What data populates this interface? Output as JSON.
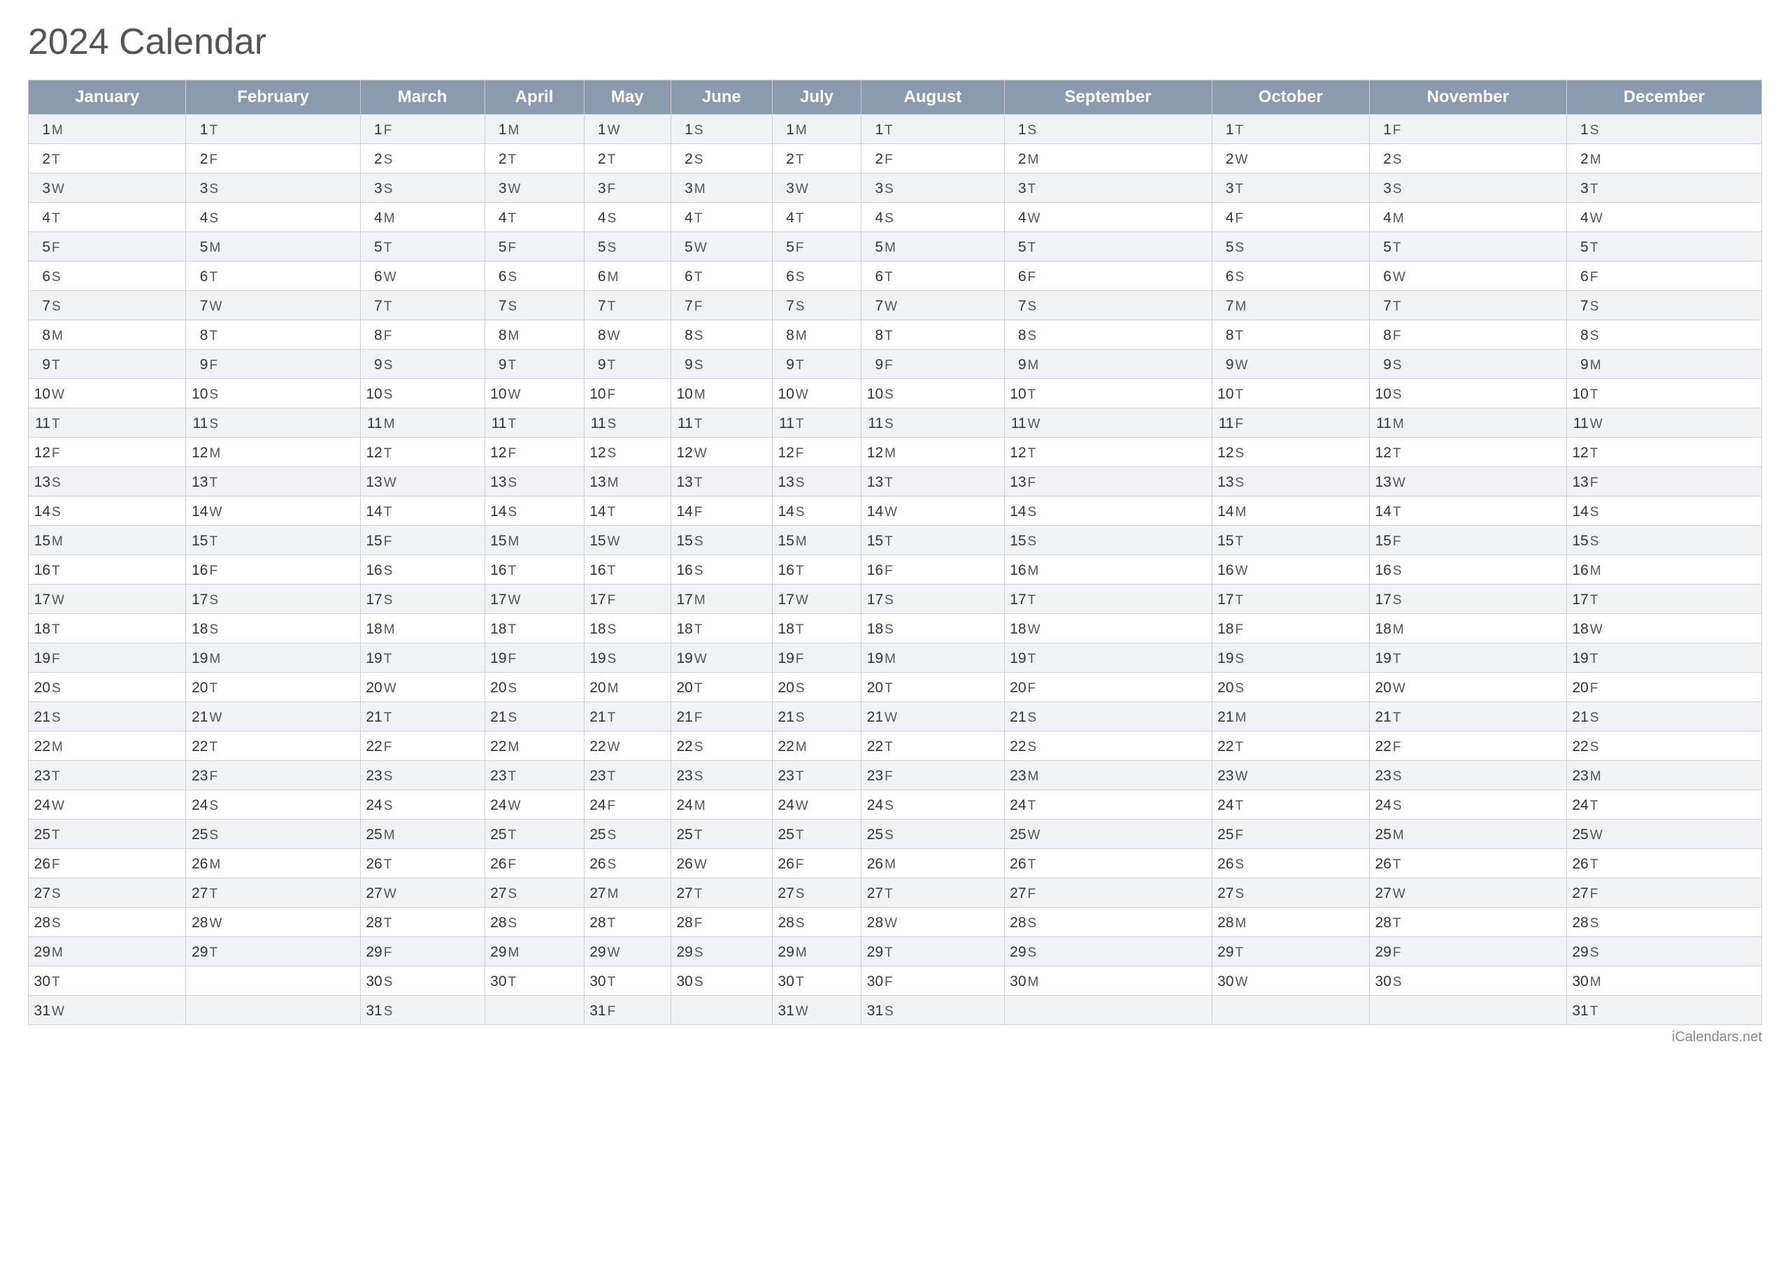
{
  "title": "2024 Calendar",
  "months": [
    "January",
    "February",
    "March",
    "April",
    "May",
    "June",
    "July",
    "August",
    "September",
    "October",
    "November",
    "December"
  ],
  "footer": "iCalendars.net",
  "rows": [
    {
      "day": 1,
      "days": [
        "M",
        "T",
        "F",
        "M",
        "W",
        "S",
        "M",
        "T",
        "S",
        "T",
        "F",
        "S"
      ]
    },
    {
      "day": 2,
      "days": [
        "T",
        "F",
        "S",
        "T",
        "T",
        "S",
        "T",
        "F",
        "M",
        "W",
        "S",
        "M"
      ]
    },
    {
      "day": 3,
      "days": [
        "W",
        "S",
        "S",
        "W",
        "F",
        "M",
        "W",
        "S",
        "T",
        "T",
        "S",
        "T"
      ]
    },
    {
      "day": 4,
      "days": [
        "T",
        "S",
        "M",
        "T",
        "S",
        "T",
        "T",
        "S",
        "W",
        "F",
        "M",
        "W"
      ]
    },
    {
      "day": 5,
      "days": [
        "F",
        "M",
        "T",
        "F",
        "S",
        "W",
        "F",
        "M",
        "T",
        "S",
        "T",
        "T"
      ]
    },
    {
      "day": 6,
      "days": [
        "S",
        "T",
        "W",
        "S",
        "M",
        "T",
        "S",
        "T",
        "F",
        "S",
        "W",
        "F"
      ]
    },
    {
      "day": 7,
      "days": [
        "S",
        "W",
        "T",
        "S",
        "T",
        "F",
        "S",
        "W",
        "S",
        "M",
        "T",
        "S"
      ]
    },
    {
      "day": 8,
      "days": [
        "M",
        "T",
        "F",
        "M",
        "W",
        "S",
        "M",
        "T",
        "S",
        "T",
        "F",
        "S"
      ]
    },
    {
      "day": 9,
      "days": [
        "T",
        "F",
        "S",
        "T",
        "T",
        "S",
        "T",
        "F",
        "M",
        "W",
        "S",
        "M"
      ]
    },
    {
      "day": 10,
      "days": [
        "W",
        "S",
        "S",
        "W",
        "F",
        "M",
        "W",
        "S",
        "T",
        "T",
        "S",
        "T"
      ]
    },
    {
      "day": 11,
      "days": [
        "T",
        "S",
        "M",
        "T",
        "S",
        "T",
        "T",
        "S",
        "W",
        "F",
        "M",
        "W"
      ]
    },
    {
      "day": 12,
      "days": [
        "F",
        "M",
        "T",
        "F",
        "S",
        "W",
        "F",
        "M",
        "T",
        "S",
        "T",
        "T"
      ]
    },
    {
      "day": 13,
      "days": [
        "S",
        "T",
        "W",
        "S",
        "M",
        "T",
        "S",
        "T",
        "F",
        "S",
        "W",
        "F"
      ]
    },
    {
      "day": 14,
      "days": [
        "S",
        "W",
        "T",
        "S",
        "T",
        "F",
        "S",
        "W",
        "S",
        "M",
        "T",
        "S"
      ]
    },
    {
      "day": 15,
      "days": [
        "M",
        "T",
        "F",
        "M",
        "W",
        "S",
        "M",
        "T",
        "S",
        "T",
        "F",
        "S"
      ]
    },
    {
      "day": 16,
      "days": [
        "T",
        "F",
        "S",
        "T",
        "T",
        "S",
        "T",
        "F",
        "M",
        "W",
        "S",
        "M"
      ]
    },
    {
      "day": 17,
      "days": [
        "W",
        "S",
        "S",
        "W",
        "F",
        "M",
        "W",
        "S",
        "T",
        "T",
        "S",
        "T"
      ]
    },
    {
      "day": 18,
      "days": [
        "T",
        "S",
        "M",
        "T",
        "S",
        "T",
        "T",
        "S",
        "W",
        "F",
        "M",
        "W"
      ]
    },
    {
      "day": 19,
      "days": [
        "F",
        "M",
        "T",
        "F",
        "S",
        "W",
        "F",
        "M",
        "T",
        "S",
        "T",
        "T"
      ]
    },
    {
      "day": 20,
      "days": [
        "S",
        "T",
        "W",
        "S",
        "M",
        "T",
        "S",
        "T",
        "F",
        "S",
        "W",
        "F"
      ]
    },
    {
      "day": 21,
      "days": [
        "S",
        "W",
        "T",
        "S",
        "T",
        "F",
        "S",
        "W",
        "S",
        "M",
        "T",
        "S"
      ]
    },
    {
      "day": 22,
      "days": [
        "M",
        "T",
        "F",
        "M",
        "W",
        "S",
        "M",
        "T",
        "S",
        "T",
        "F",
        "S"
      ]
    },
    {
      "day": 23,
      "days": [
        "T",
        "F",
        "S",
        "T",
        "T",
        "S",
        "T",
        "F",
        "M",
        "W",
        "S",
        "M"
      ]
    },
    {
      "day": 24,
      "days": [
        "W",
        "S",
        "S",
        "W",
        "F",
        "M",
        "W",
        "S",
        "T",
        "T",
        "S",
        "T"
      ]
    },
    {
      "day": 25,
      "days": [
        "T",
        "S",
        "M",
        "T",
        "S",
        "T",
        "T",
        "S",
        "W",
        "F",
        "M",
        "W"
      ]
    },
    {
      "day": 26,
      "days": [
        "F",
        "M",
        "T",
        "F",
        "S",
        "W",
        "F",
        "M",
        "T",
        "S",
        "T",
        "T"
      ]
    },
    {
      "day": 27,
      "days": [
        "S",
        "T",
        "W",
        "S",
        "M",
        "T",
        "S",
        "T",
        "F",
        "S",
        "W",
        "F"
      ]
    },
    {
      "day": 28,
      "days": [
        "S",
        "W",
        "T",
        "S",
        "T",
        "F",
        "S",
        "W",
        "S",
        "M",
        "T",
        "S"
      ]
    },
    {
      "day": 29,
      "days": [
        "M",
        "T",
        "F",
        "M",
        "W",
        "S",
        "M",
        "T",
        "S",
        "T",
        "F",
        "S"
      ]
    },
    {
      "day": 30,
      "days": [
        "T",
        null,
        "S",
        "T",
        "T",
        "S",
        "T",
        "F",
        "M",
        "W",
        "S",
        "M"
      ]
    },
    {
      "day": 31,
      "days": [
        "W",
        null,
        "S",
        null,
        "F",
        null,
        "W",
        "S",
        null,
        null,
        null,
        "T"
      ]
    }
  ]
}
